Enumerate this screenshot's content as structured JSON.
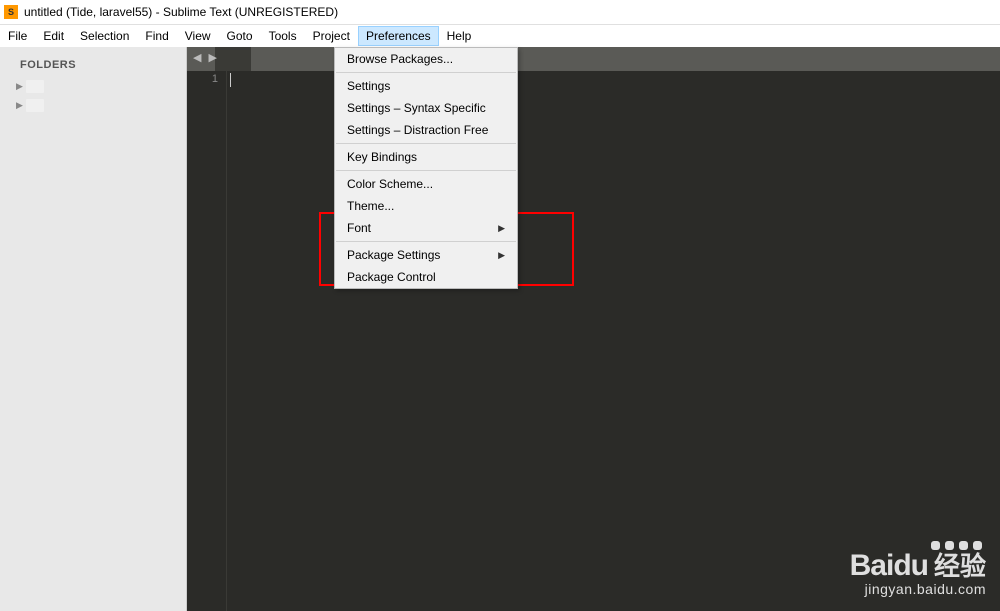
{
  "titlebar": {
    "title": "untitled (Tide, laravel55) - Sublime Text (UNREGISTERED)"
  },
  "menubar": {
    "items": [
      "File",
      "Edit",
      "Selection",
      "Find",
      "View",
      "Goto",
      "Tools",
      "Project",
      "Preferences",
      "Help"
    ],
    "active": "Preferences"
  },
  "sidebar": {
    "header": "FOLDERS",
    "items": [
      {
        "label": ""
      },
      {
        "label": ""
      }
    ]
  },
  "editor": {
    "nav_arrows": "◀ ▶",
    "line_number": "1"
  },
  "dropdown": {
    "groups": [
      [
        {
          "label": "Browse Packages..."
        }
      ],
      [
        {
          "label": "Settings"
        },
        {
          "label": "Settings – Syntax Specific"
        },
        {
          "label": "Settings – Distraction Free"
        }
      ],
      [
        {
          "label": "Key Bindings"
        }
      ],
      [
        {
          "label": "Color Scheme..."
        },
        {
          "label": "Theme..."
        },
        {
          "label": "Font",
          "submenu": true
        }
      ],
      [
        {
          "label": "Package Settings",
          "submenu": true
        },
        {
          "label": "Package Control"
        }
      ]
    ]
  },
  "watermark": {
    "baidu": "Bai",
    "du": "du",
    "jingyan": "经验",
    "url": "jingyan.baidu.com"
  }
}
